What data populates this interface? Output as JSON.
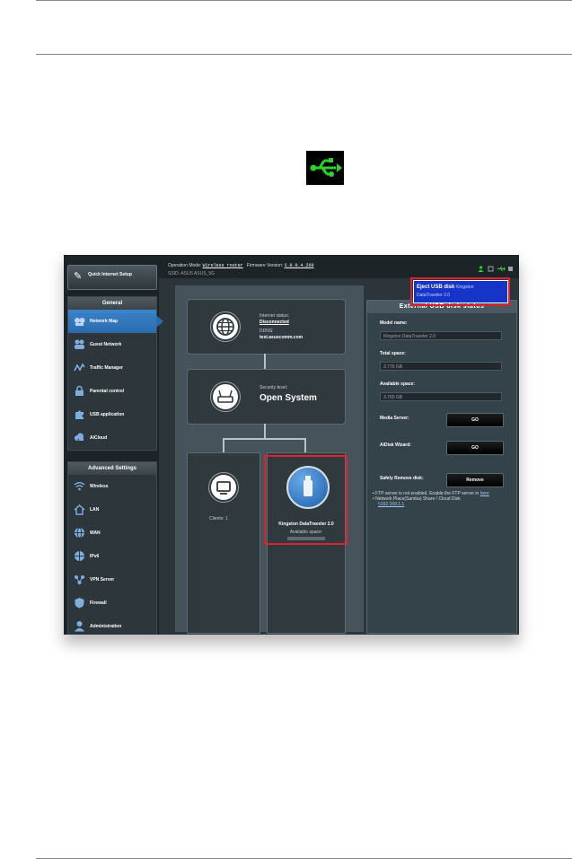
{
  "topbar": {
    "operation_mode_label": "Operation Mode:",
    "operation_mode_value": "Wireless router",
    "firmware_label": "Firmware Version:",
    "firmware_value": "3.0.0.4.260",
    "ssid_label": "SSID:",
    "ssid_value": "ASUS ASUS_5G"
  },
  "sidebar": {
    "quick_setup": "Quick Internet Setup",
    "general_title": "General",
    "general_items": [
      {
        "label": "Network Map",
        "icon": "network-map-icon"
      },
      {
        "label": "Guest Network",
        "icon": "guest-network-icon"
      },
      {
        "label": "Traffic Manager",
        "icon": "traffic-manager-icon"
      },
      {
        "label": "Parental control",
        "icon": "lock-icon"
      },
      {
        "label": "USB application",
        "icon": "puzzle-icon"
      },
      {
        "label": "AiCloud",
        "icon": "cloud-icon"
      }
    ],
    "advanced_title": "Advanced Settings",
    "advanced_items": [
      {
        "label": "Wireless",
        "icon": "wireless-icon"
      },
      {
        "label": "LAN",
        "icon": "home-icon"
      },
      {
        "label": "WAN",
        "icon": "globe-icon"
      },
      {
        "label": "IPv6",
        "icon": "ipv6-icon"
      },
      {
        "label": "VPN Server",
        "icon": "vpn-icon"
      },
      {
        "label": "Firewall",
        "icon": "shield-icon"
      },
      {
        "label": "Administration",
        "icon": "admin-icon"
      }
    ]
  },
  "map": {
    "internet_status_label": "Internet status:",
    "internet_status_value": "Disconnected",
    "ddns_label": "DDNS:",
    "ddns_value": "test.asuscomm.com",
    "security_label": "Security level:",
    "security_value": "Open System",
    "clients_label": "Clients:",
    "clients_value": "1",
    "usb_device_name": "Kingston DataTraveler 2.0",
    "usb_available": "Available space:"
  },
  "external": {
    "title": "External USB disk status",
    "model_label": "Model name:",
    "model_value": "Kingston DataTraveler 2.0",
    "total_label": "Total space:",
    "total_value": "3.776 GB",
    "available_label": "Available space:",
    "available_value": "3.765 GB",
    "media_label": "Media Server:",
    "media_button": "GO",
    "aidisk_label": "AiDisk Wizard:",
    "aidisk_button": "GO",
    "safely_label": "Safely Remove disk:",
    "remove_button": "Remove",
    "note1_prefix": "FTP server is not enabled. Enable the FTP server in",
    "note1_link": "here",
    "note2": "Network Place(Samba) Share / Cloud Disk",
    "note2_link": "\\\\192.168.1.1"
  },
  "popup": {
    "line1_bold": "Eject USB disk",
    "line1_rest": "Kingston",
    "line2": "DataTraveler 2.0"
  },
  "colors": {
    "usb_green": "#2fd12f",
    "highlight_red": "#d9232e",
    "popup_blue": "#1635c8"
  }
}
